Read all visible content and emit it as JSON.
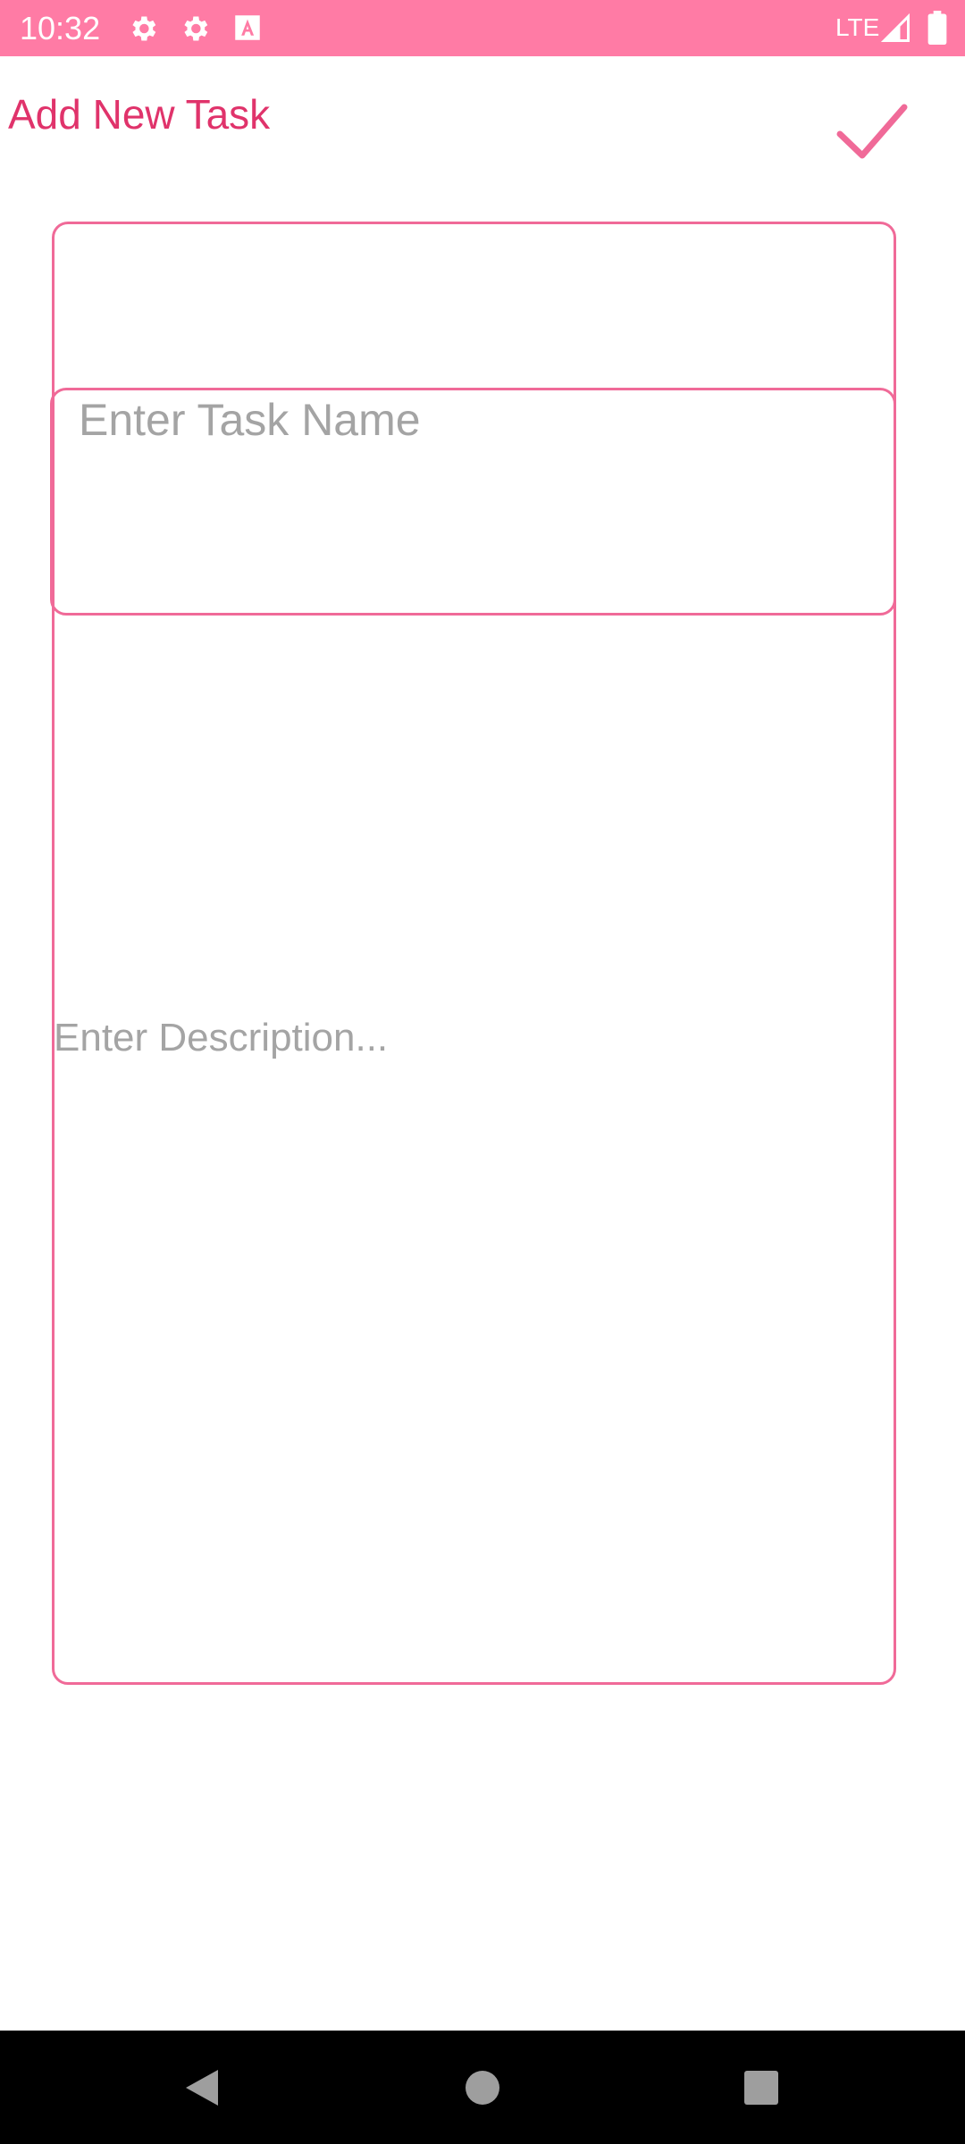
{
  "status_bar": {
    "time": "10:32",
    "network": "LTE",
    "icons": [
      "gear-icon",
      "gear-icon",
      "a-box-icon",
      "signal-icon",
      "battery-icon"
    ],
    "background_color": "#FF7BA5"
  },
  "app_bar": {
    "title": "Add New Task",
    "confirm_icon": "check-icon",
    "accent_color": "#E0336B"
  },
  "form": {
    "task_name_placeholder": "Enter Task Name",
    "description_placeholder": "Enter Description...",
    "border_color": "#F06A98"
  },
  "nav_bar": {
    "icons": [
      "back-icon",
      "home-icon",
      "recents-icon"
    ]
  }
}
